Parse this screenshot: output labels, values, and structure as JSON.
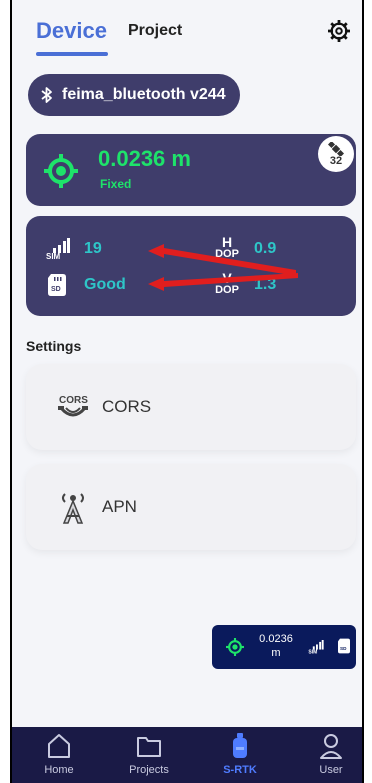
{
  "tabs": {
    "device": "Device",
    "project": "Project"
  },
  "device": {
    "name": "feima_bluetooth v244"
  },
  "accuracy": {
    "value": "0.0236 m",
    "status": "Fixed",
    "satellites": "32"
  },
  "status": {
    "sim_signal": "19",
    "sd_status": "Good",
    "hdop_label_top": "H",
    "hdop_label_bottom": "DOP",
    "hdop_value": "0.9",
    "vdop_label_top": "V",
    "vdop_label_bottom": "DOP",
    "vdop_value": "1.3",
    "sim_icon_text": "SIM",
    "sd_icon_text": "SD"
  },
  "settings": {
    "title": "Settings",
    "items": [
      {
        "label": "CORS",
        "icon": "cors-icon",
        "icon_text": "CORS"
      },
      {
        "label": "APN",
        "icon": "apn-antenna-icon"
      }
    ]
  },
  "float_widget": {
    "accuracy_line1": "0.0236",
    "accuracy_line2": "m"
  },
  "nav": {
    "items": [
      {
        "label": "Home"
      },
      {
        "label": "Projects"
      },
      {
        "label": "S-RTK",
        "active": true
      },
      {
        "label": "User"
      }
    ]
  },
  "colors": {
    "accent": "#4a6fd6",
    "card": "#3f3d6b",
    "fixed_green": "#1ee36a",
    "value_teal": "#2ec6c8",
    "nav_bg": "#1a1a46",
    "nav_active": "#4f7cff",
    "annotation_arrow": "#e01e1e"
  }
}
